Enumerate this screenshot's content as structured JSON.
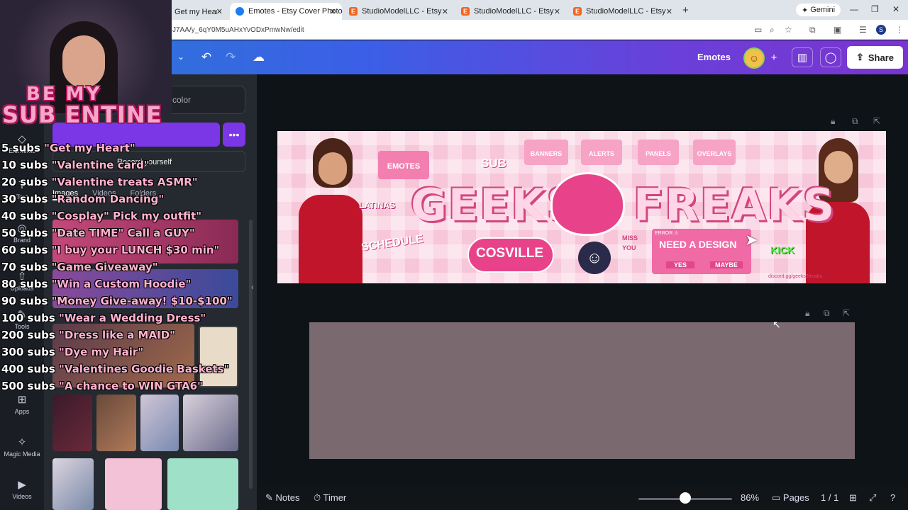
{
  "browser": {
    "tabs": [
      {
        "title": "Get my Heart\" ❤",
        "favicon": "heart-favicon",
        "active": false
      },
      {
        "title": "Emotes - Etsy Cover Photo",
        "favicon": "canva-favicon",
        "active": true
      },
      {
        "title": "StudioModelLLC - Etsy",
        "favicon": "etsy-favicon",
        "active": false
      },
      {
        "title": "StudioModelLLC - Etsy",
        "favicon": "etsy-favicon",
        "active": false
      },
      {
        "title": "StudioModelLLC - Etsy",
        "favicon": "etsy-favicon",
        "active": false
      }
    ],
    "url": "J7AA/y_6qY0M5uAHxYvODxPmwNw/edit",
    "gemini_label": "Gemini",
    "profile_initial": "S"
  },
  "header": {
    "title": "Emotes",
    "share_label": "Share"
  },
  "rail": [
    {
      "label": "Elements",
      "icon": "shapes-icon"
    },
    {
      "label": "Text",
      "icon": "text-icon"
    },
    {
      "label": "Brand",
      "icon": "brand-icon"
    },
    {
      "label": "Uploads",
      "icon": "upload-icon"
    },
    {
      "label": "Tools",
      "icon": "tools-icon"
    },
    {
      "label": "Apps",
      "icon": "apps-icon"
    },
    {
      "label": "Magic Media",
      "icon": "magic-icon"
    },
    {
      "label": "Videos",
      "icon": "video-icon"
    }
  ],
  "panel": {
    "search_text": "color",
    "record_label": "Record yourself",
    "tabs": [
      "Images",
      "Videos",
      "Folders"
    ]
  },
  "stream": {
    "badge_line1": "BE MY",
    "badge_line2": "SUB ENTINE",
    "goals": [
      {
        "count": "5 subs",
        "text": " \"Get my Heart\""
      },
      {
        "count": "10 subs",
        "text": " \"Valentine card\""
      },
      {
        "count": "20 subs",
        "text": " \"Valentine treats ASMR\""
      },
      {
        "count": "30 subs",
        "text": " \"Random Dancing\""
      },
      {
        "count": "40 subs",
        "text": " \"Cosplay\" Pick my outfit\""
      },
      {
        "count": "50 subs",
        "text": " \"Date TIME\" Call a GUY\""
      },
      {
        "count": "60 subs",
        "text": " \"I buy your LUNCH $30 min\""
      },
      {
        "count": "70 subs",
        "text": " \"Game Giveaway\""
      },
      {
        "count": "80 subs",
        "text": " \"Win a Custom Hoodie\""
      },
      {
        "count": "90 subs",
        "text": " \"Money Give-away! $10-$100\""
      },
      {
        "count": "100 subs",
        "text": " \"Wear a Wedding Dress\""
      },
      {
        "count": "200 subs",
        "text": " \"Dress like a MAID\""
      },
      {
        "count": "300 subs",
        "text": " \"Dye my Hair\""
      },
      {
        "count": "400 subs",
        "text": " \"Valentines Goodie Baskets\""
      },
      {
        "count": "500 subs",
        "text": " \"A chance to WIN GTA6\""
      }
    ]
  },
  "banner": {
    "main_text": "GEEKS FREAKS",
    "left_text": "GEEKS",
    "right_text": "FREAKS",
    "folders": [
      "EMOTES",
      "BANNERS",
      "ALERTS",
      "PANELS",
      "OVERLAYS"
    ],
    "sub_label": "SUB",
    "latinas": "LATINAS",
    "schedule": "SCHEDULE",
    "cosville": "COSVILLE",
    "design_prompt": "NEED A DESIGN",
    "yes": "YES",
    "maybe": "MAYBE",
    "error": "ERROR ⚠",
    "kick": "KICK",
    "miss_you": "MISS YOU",
    "discord": "discord.gg/geeks3freaks"
  },
  "bottom": {
    "notes": "Notes",
    "timer": "Timer",
    "zoom": "86%",
    "zoom_fraction": 0.5,
    "pages": "Pages",
    "page_count": "1 / 1"
  },
  "colors": {
    "accent_purple": "#7b36e6",
    "banner_pink": "#f7c6d8",
    "goal_pink": "#ffb3cf",
    "page2_fill": "#7a6a70"
  }
}
